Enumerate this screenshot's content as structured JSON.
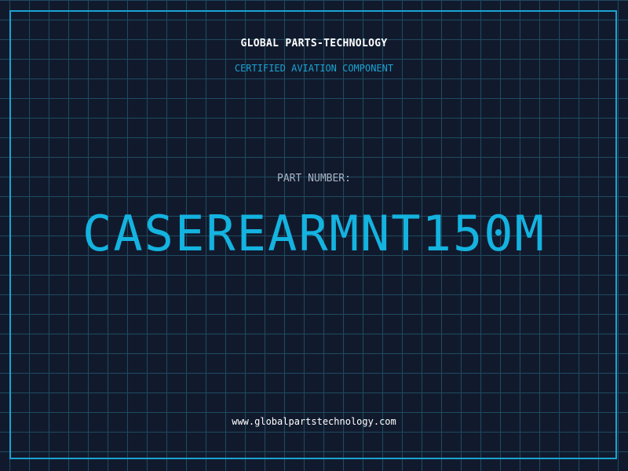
{
  "header": {
    "company": "GLOBAL PARTS-TECHNOLOGY",
    "tagline": "CERTIFIED AVIATION COMPONENT"
  },
  "main": {
    "part_label": "PART NUMBER:",
    "part_number": "CASEREARMNT150M"
  },
  "footer": {
    "website": "www.globalpartstechnology.com"
  },
  "colors": {
    "background": "#111a2d",
    "grid": "#1f4a5f",
    "accent": "#1aa3d1",
    "part_number": "#14b3e0",
    "label": "#a7b4c4",
    "text": "#ffffff"
  }
}
